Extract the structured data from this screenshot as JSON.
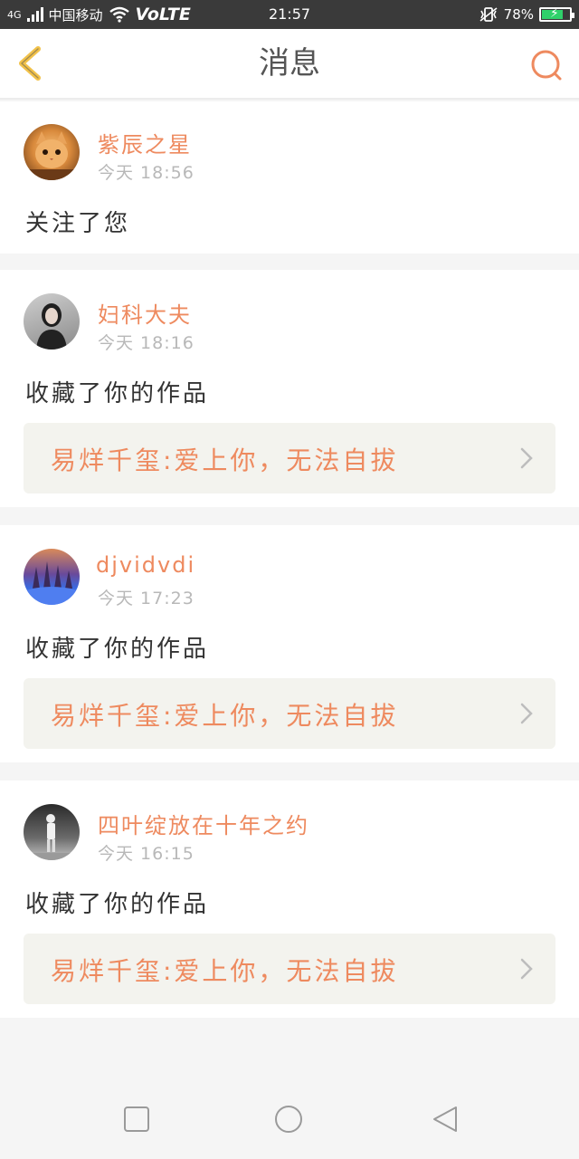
{
  "status_bar": {
    "carrier": "中国移动",
    "network": "VoLTE",
    "network_type": "4G",
    "time": "21:57",
    "battery": "78%",
    "battery_level": 0.78
  },
  "header": {
    "title": "消息",
    "back_icon": "back-chevron-icon",
    "search_icon": "search-icon"
  },
  "messages": [
    {
      "user": "紫辰之星",
      "time": "今天 18:56",
      "action": "关注了您",
      "work": null
    },
    {
      "user": "妇科大夫",
      "time": "今天 18:16",
      "action": "收藏了你的作品",
      "work": "易烊千玺:爱上你，无法自拔"
    },
    {
      "user": "djvidvdi",
      "time": "今天 17:23",
      "action": "收藏了你的作品",
      "work": "易烊千玺:爱上你，无法自拔"
    },
    {
      "user": "四叶绽放在十年之约",
      "time": "今天 16:15",
      "action": "收藏了你的作品",
      "work": "易烊千玺:爱上你，无法自拔"
    }
  ],
  "colors": {
    "accent": "#ee8a5f",
    "back_icon": "#f2c24a",
    "status_bar": "#3a3a3a"
  }
}
